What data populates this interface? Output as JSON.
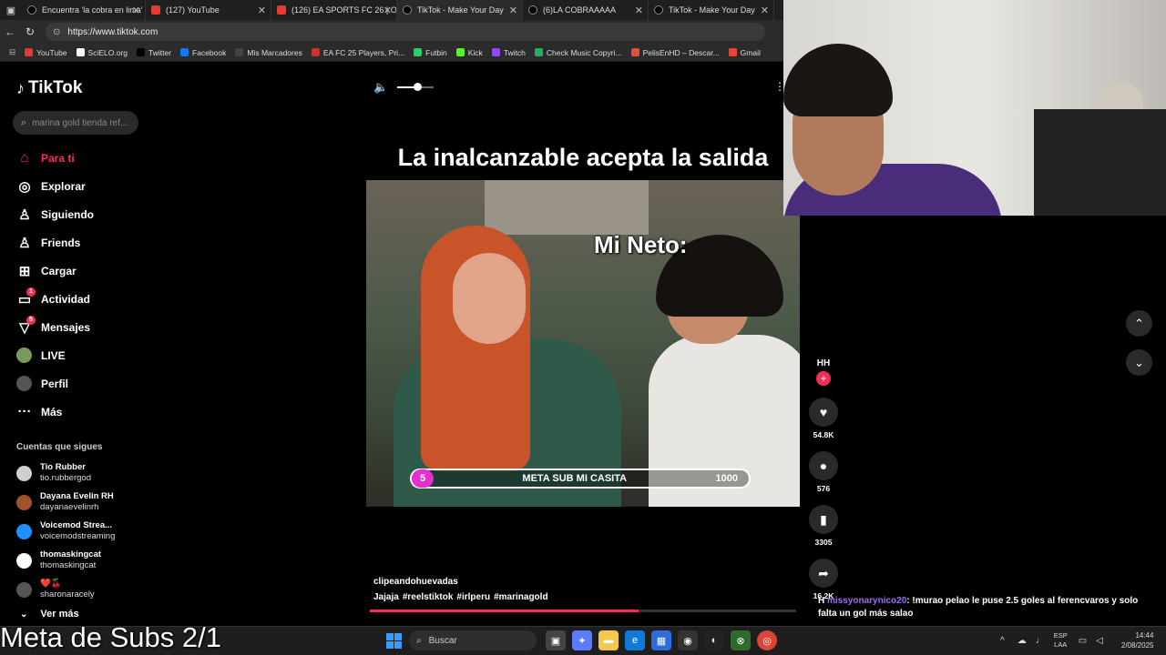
{
  "browser": {
    "tabs": [
      {
        "label": "Encuentra 'la cobra en lima'",
        "icon": "tiktok-icon",
        "active": false
      },
      {
        "label": "(127) YouTube",
        "icon": "youtube-icon",
        "active": false
      },
      {
        "label": "(126) EA SPORTS FC 26 | Of",
        "icon": "youtube-icon",
        "active": false
      },
      {
        "label": "TikTok - Make Your Day",
        "icon": "tiktok-icon",
        "active": true
      },
      {
        "label": "(6)LA COBRAAAAA",
        "icon": "tiktok-icon",
        "active": false
      },
      {
        "label": "TikTok - Make Your Day",
        "icon": "tiktok-icon",
        "active": false
      }
    ],
    "url": "https://www.tiktok.com",
    "bookmarks": [
      {
        "label": "YouTube",
        "color": "#e53935"
      },
      {
        "label": "SciELO.org",
        "color": "#ffffff"
      },
      {
        "label": "Twitter",
        "color": "#000000"
      },
      {
        "label": "Facebook",
        "color": "#1877f2"
      },
      {
        "label": "Mis Marcadores",
        "color": "#444444"
      },
      {
        "label": "EA FC 25 Players, Pri...",
        "color": "#c0392b"
      },
      {
        "label": "Futbin",
        "color": "#2ecc71"
      },
      {
        "label": "Kick",
        "color": "#53fc18"
      },
      {
        "label": "Twitch",
        "color": "#9146ff"
      },
      {
        "label": "Check Music Copyri...",
        "color": "#27ae60"
      },
      {
        "label": "PelisEnHD – Descar...",
        "color": "#e74c3c"
      },
      {
        "label": "Gmail",
        "color": "#ea4335"
      }
    ]
  },
  "tiktok": {
    "logo": "TikTok",
    "search_placeholder": "marina gold tienda ref...",
    "menu": [
      {
        "label": "Para ti",
        "icon": "home-icon",
        "glyph": "⌂",
        "active": true
      },
      {
        "label": "Explorar",
        "icon": "compass-icon",
        "glyph": "◎",
        "active": false
      },
      {
        "label": "Siguiendo",
        "icon": "following-icon",
        "glyph": "♙",
        "active": false
      },
      {
        "label": "Friends",
        "icon": "friends-icon",
        "glyph": "♙",
        "active": false
      },
      {
        "label": "Cargar",
        "icon": "upload-icon",
        "glyph": "⊞",
        "active": false
      },
      {
        "label": "Actividad",
        "icon": "activity-icon",
        "glyph": "▭",
        "active": false,
        "badge": "1"
      },
      {
        "label": "Mensajes",
        "icon": "messages-icon",
        "glyph": "▽",
        "active": false,
        "badge": "5"
      },
      {
        "label": "LIVE",
        "icon": "live-avatar",
        "glyph": "",
        "active": false
      },
      {
        "label": "Perfil",
        "icon": "profile-avatar",
        "glyph": "",
        "active": false
      },
      {
        "label": "Más",
        "icon": "more-icon",
        "glyph": "···",
        "active": false
      }
    ],
    "following_title": "Cuentas que sigues",
    "following": [
      {
        "name": "Tio Rubber",
        "handle": "tio.rubbergod",
        "color": "#cfcfcf"
      },
      {
        "name": "Dayana Evelin RH",
        "handle": "dayanaevelinrh",
        "color": "#a0522d"
      },
      {
        "name": "Voicemod Strea...",
        "handle": "voicemodstreaming",
        "color": "#1e90ff"
      },
      {
        "name": "thomaskingcat",
        "handle": "thomaskingcat",
        "color": "#ffffff"
      },
      {
        "name": "❤️🍒",
        "handle": "sharonaracely",
        "color": "#555555"
      }
    ],
    "see_more": "Ver más"
  },
  "video": {
    "title": "La inalcanzable acepta la salida",
    "overlay_text": "Mi Neto:",
    "goal_bar": {
      "count": "5",
      "label": "META SUB MI CASITA",
      "goal": "1000"
    },
    "author": "clipeandohuevadas",
    "caption_parts": [
      "Jajaja",
      "#reelstiktok",
      "#irlperu",
      "#marinagold"
    ],
    "progress": 0.63,
    "volume": 0.55
  },
  "actions": {
    "author": "HH",
    "likes": "54.8K",
    "comments": "576",
    "saves": "3305",
    "shares": "16.2K"
  },
  "chat": {
    "prefix": "H",
    "user": "missyonarynico20",
    "message": ": !murao pelao le puse 2.5 goles al ferencvaros y solo falta un gol más salao"
  },
  "overlay": {
    "stream_text": "Meta de Subs 2/1"
  },
  "taskbar": {
    "search": "Buscar",
    "lang_top": "ESP",
    "lang_bottom": "LAA",
    "time": "14:44",
    "date": "2/08/2025"
  }
}
